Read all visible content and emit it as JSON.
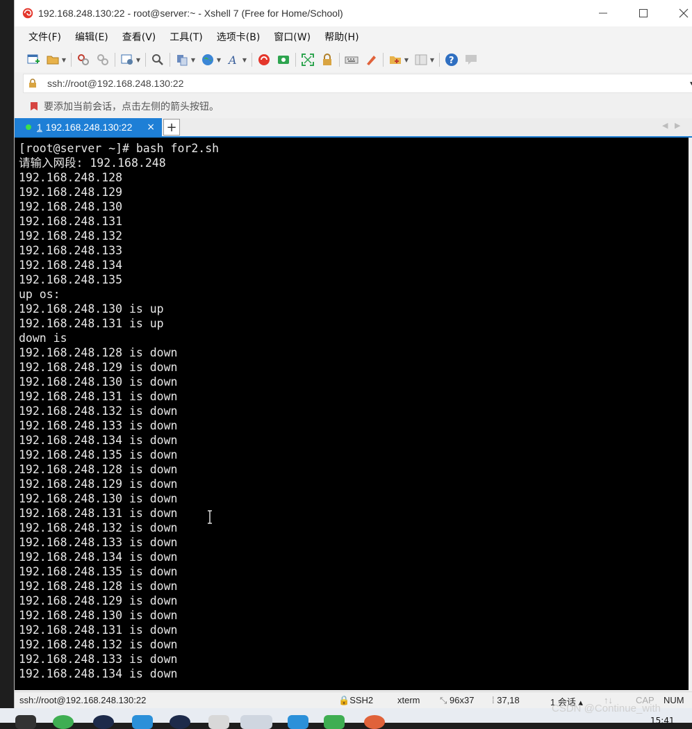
{
  "window": {
    "title": "192.168.248.130:22 - root@server:~ - Xshell 7 (Free for Home/School)"
  },
  "menu": {
    "items": [
      {
        "label": "文件(F)"
      },
      {
        "label": "编辑(E)"
      },
      {
        "label": "查看(V)"
      },
      {
        "label": "工具(T)"
      },
      {
        "label": "选项卡(B)"
      },
      {
        "label": "窗口(W)"
      },
      {
        "label": "帮助(H)"
      }
    ]
  },
  "toolbar": {
    "icons": [
      "new-session-icon",
      "open-folder-icon",
      "reconnect-icon",
      "disconnect-icon",
      "properties-icon",
      "find-icon",
      "copy-paste-icon",
      "globe-icon",
      "font-icon",
      "xftp-icon",
      "xagent-icon",
      "fullscreen-icon",
      "lock-icon",
      "keyboard-icon",
      "highlight-icon",
      "new-folder-icon",
      "layout-icon",
      "help-icon",
      "chat-icon"
    ]
  },
  "address": {
    "value": "ssh://root@192.168.248.130:22"
  },
  "hint": {
    "text": "要添加当前会话，点击左侧的箭头按钮。"
  },
  "tabs": [
    {
      "number": "1",
      "label": "192.168.248.130:22",
      "close": "×",
      "active": true
    }
  ],
  "tab_add_label": "+",
  "terminal": {
    "lines": [
      "[root@server ~]# bash for2.sh",
      "请输入网段: 192.168.248",
      "192.168.248.128",
      "192.168.248.129",
      "192.168.248.130",
      "192.168.248.131",
      "192.168.248.132",
      "192.168.248.133",
      "192.168.248.134",
      "192.168.248.135",
      "up os:",
      "192.168.248.130 is up",
      "192.168.248.131 is up",
      "down is",
      "192.168.248.128 is down",
      "192.168.248.129 is down",
      "192.168.248.130 is down",
      "192.168.248.131 is down",
      "192.168.248.132 is down",
      "192.168.248.133 is down",
      "192.168.248.134 is down",
      "192.168.248.135 is down",
      "192.168.248.128 is down",
      "192.168.248.129 is down",
      "192.168.248.130 is down",
      "192.168.248.131 is down",
      "192.168.248.132 is down",
      "192.168.248.133 is down",
      "192.168.248.134 is down",
      "192.168.248.135 is down",
      "192.168.248.128 is down",
      "192.168.248.129 is down",
      "192.168.248.130 is down",
      "192.168.248.131 is down",
      "192.168.248.132 is down",
      "192.168.248.133 is down",
      "192.168.248.134 is down"
    ]
  },
  "status": {
    "address": "ssh://root@192.168.248.130:22",
    "protocol": "SSH2",
    "terminal_type": "xterm",
    "size": "96x37",
    "cursor": "37,18",
    "sessions": "1 会话",
    "cap": "CAP",
    "num": "NUM"
  },
  "watermark": "CSDN @Continue_with",
  "clock": "15:41",
  "colors": {
    "tab_active": "#1e7fd6",
    "terminal_bg": "#000000",
    "terminal_fg": "#e8e8e8",
    "session_dot": "#3ce04a"
  }
}
